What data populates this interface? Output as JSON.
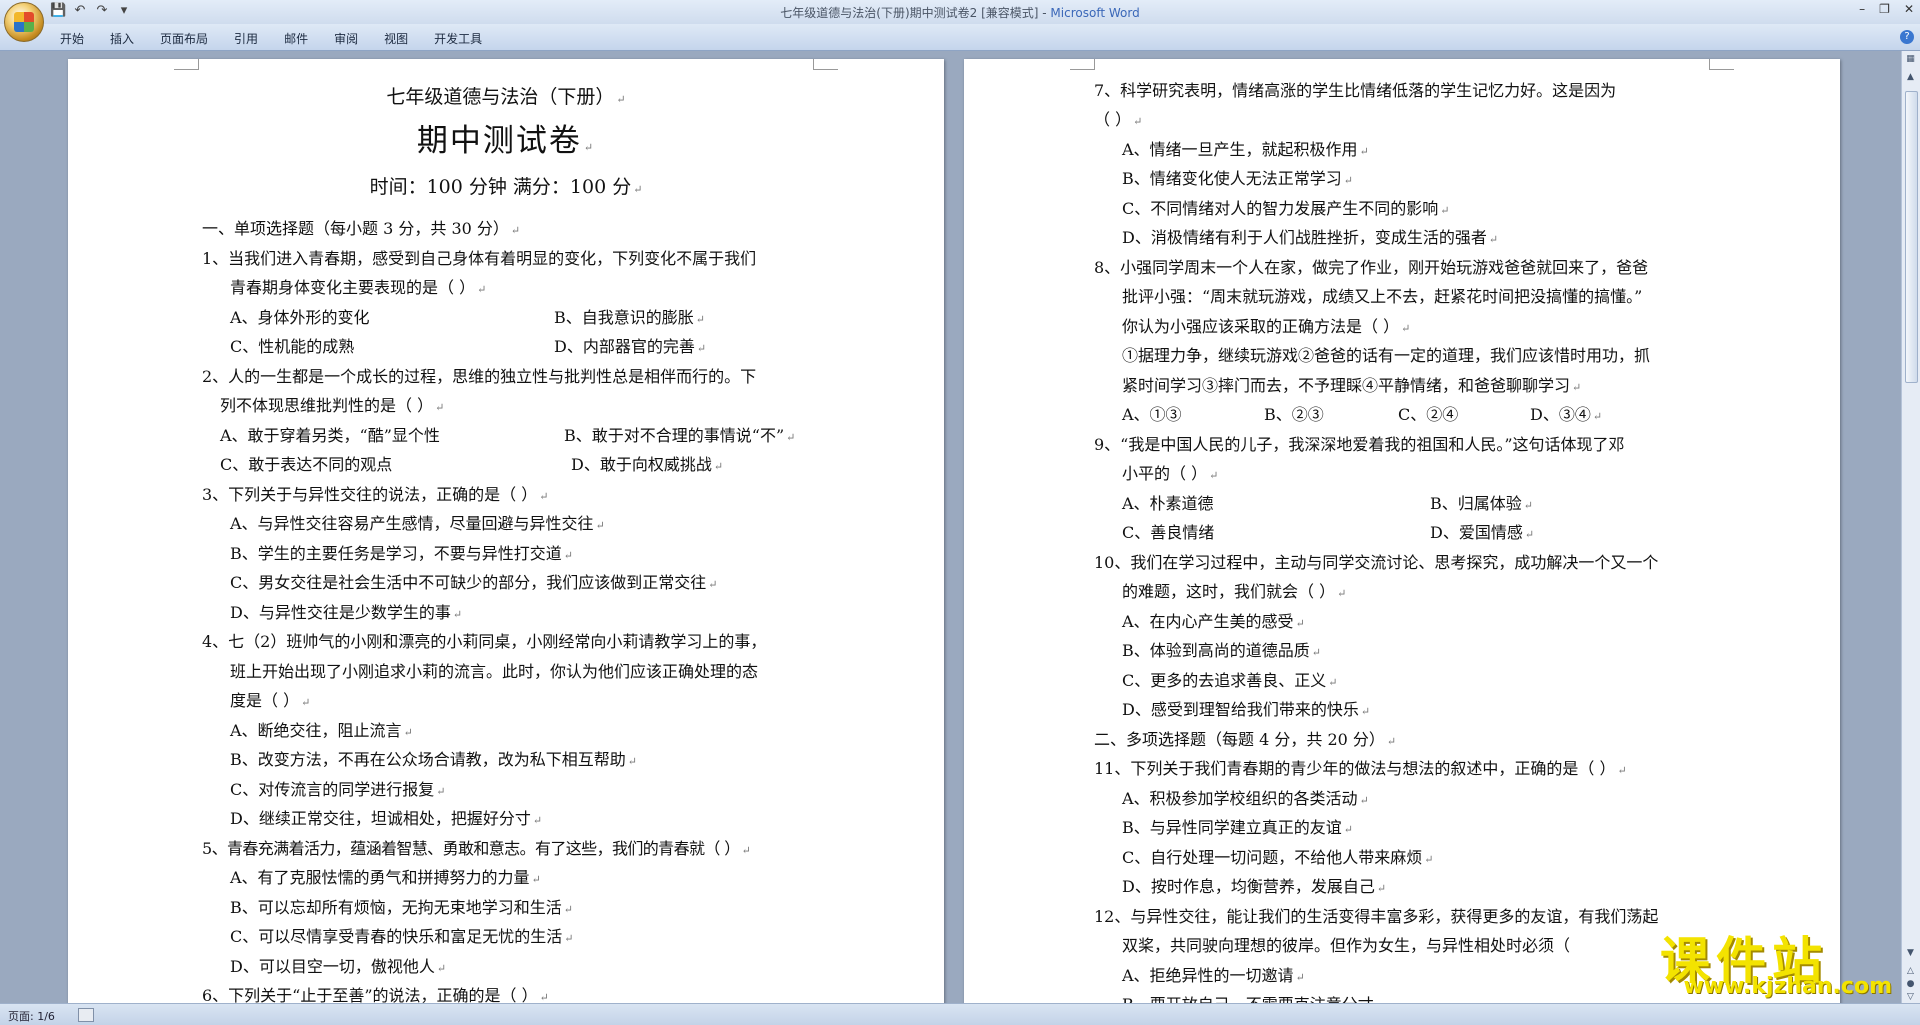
{
  "window": {
    "title": "七年级道德与法治(下册)期中测试卷2 [兼容模式] - ",
    "app": "Microsoft Word"
  },
  "ribbon": {
    "tabs": [
      "开始",
      "插入",
      "页面布局",
      "引用",
      "邮件",
      "审阅",
      "视图",
      "开发工具"
    ]
  },
  "status": {
    "page": "页面: 1/6"
  },
  "watermark": {
    "title": "课件站",
    "url": "www.kjzhan.com"
  },
  "page1": {
    "subject": "七年级道德与法治（下册）",
    "title": "期中测试卷",
    "info": "时间：100 分钟        满分：100 分",
    "lines": [
      "一、单项选择题（每小题 3 分，共 30 分）",
      "1、当我们进入青春期，感受到自己身体有着明显的变化，下列变化不属于我们",
      "青春期身体变化主要表现的是（      ）",
      "A、身体外形的变化",
      "B、自我意识的膨胀",
      "C、性机能的成熟",
      "D、内部器官的完善",
      "2、人的一生都是一个成长的过程，思维的独立性与批判性总是相伴而行的。下",
      "列不体现思维批判性的是（      ）",
      "A、敢于穿着另类，“酷”显个性",
      "B、敢于对不合理的事情说“不”",
      "C、敢于表达不同的观点",
      "D、敢于向权威挑战",
      "3、下列关于与异性交往的说法，正确的是（      ）",
      "A、与异性交往容易产生感情，尽量回避与异性交往",
      "B、学生的主要任务是学习，不要与异性打交道",
      "C、男女交往是社会生活中不可缺少的部分，我们应该做到正常交往",
      "D、与异性交往是少数学生的事",
      "4、七（2）班帅气的小刚和漂亮的小莉同桌，小刚经常向小莉请教学习上的事，",
      "班上开始出现了小刚追求小莉的流言。此时，你认为他们应该正确处理的态",
      "度是（      ）",
      "A、断绝交往，阻止流言",
      "B、改变方法，不再在公众场合请教，改为私下相互帮助",
      "C、对传流言的同学进行报复",
      "D、继续正常交往，坦诚相处，把握好分寸",
      "5、青春充满着活力，蕴涵着智慧、勇敢和意志。有了这些，我们的青春就（      ）",
      "A、有了克服怯懦的勇气和拼搏努力的力量",
      "B、可以忘却所有烦恼，无拘无束地学习和生活",
      "C、可以尽情享受青春的快乐和富足无忧的生活",
      "D、可以目空一切，傲视他人",
      "6、下列关于“止于至善”的说法，正确的是（      ）"
    ]
  },
  "page2": {
    "lines": [
      "7、科学研究表明，情绪高涨的学生比情绪低落的学生记忆力好。这是因为",
      "（      ）",
      "A、情绪一旦产生，就起积极作用",
      "B、情绪变化使人无法正常学习",
      "C、不同情绪对人的智力发展产生不同的影响",
      "D、消极情绪有利于人们战胜挫折，变成生活的强者",
      "8、小强同学周末一个人在家，做完了作业，刚开始玩游戏爸爸就回来了，爸爸",
      "批评小强：“周末就玩游戏，成绩又上不去，赶紧花时间把没搞懂的搞懂。”",
      "你认为小强应该采取的正确方法是（      ）",
      "①据理力争，继续玩游戏②爸爸的话有一定的道理，我们应该惜时用功，抓",
      "紧时间学习③摔门而去，不予理睬④平静情绪，和爸爸聊聊学习",
      "A、①③",
      "B、②③",
      "C、②④",
      "D、③④",
      "9、“我是中国人民的儿子，我深深地爱着我的祖国和人民。”这句话体现了邓",
      "小平的（      ）",
      "A、朴素道德",
      "B、归属体验",
      "C、善良情绪",
      "D、爱国情感",
      "10、我们在学习过程中，主动与同学交流讨论、思考探究，成功解决一个又一个",
      "的难题，这时，我们就会（      ）",
      "A、在内心产生美的感受",
      "B、体验到高尚的道德品质",
      "C、更多的去追求善良、正义",
      "D、感受到理智给我们带来的快乐",
      "二、多项选择题（每题 4 分，共 20 分）",
      "11、下列关于我们青春期的青少年的做法与想法的叙述中，正确的是（      ）",
      "A、积极参加学校组织的各类活动",
      "B、与异性同学建立真正的友谊",
      "C、自行处理一切问题，不给他人带来麻烦",
      "D、按时作息，均衡营养，发展自己",
      "12、与异性交往，能让我们的生活变得丰富多彩，获得更多的友谊，有我们荡起",
      "双桨，共同驶向理想的彼岸。但作为女生，与异性相处时必须（",
      "A、拒绝异性的一切邀请",
      "B、要开放自己，不需要克注意分寸"
    ]
  }
}
